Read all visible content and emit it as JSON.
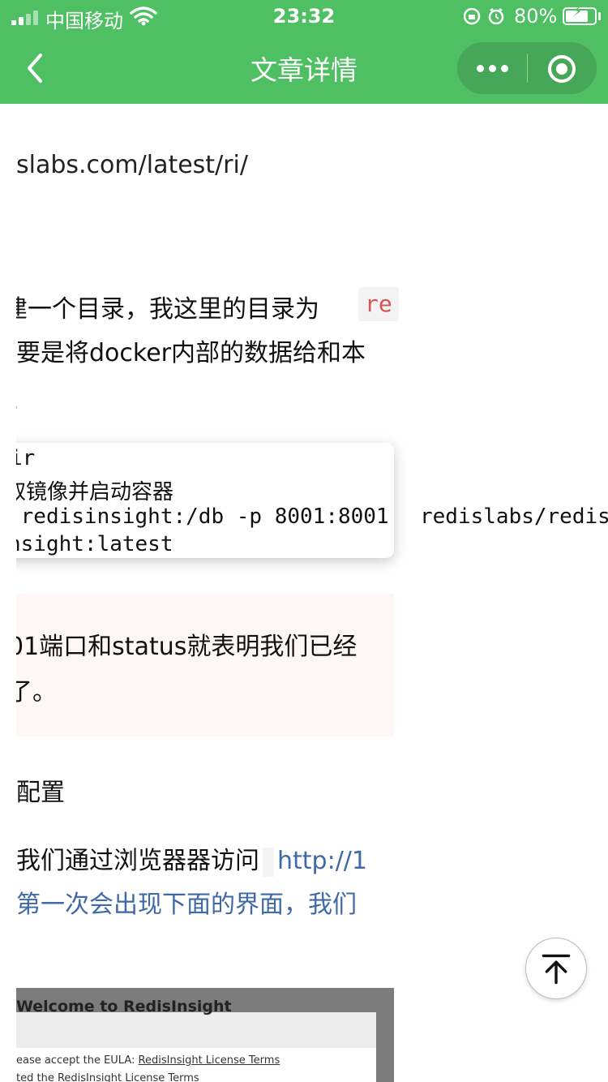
{
  "status_bar": {
    "carrier": "中国移动",
    "time": "23:32",
    "battery": "80%",
    "battery_level": 0.8
  },
  "nav": {
    "title": "文章详情",
    "back_icon": "chevron-left-icon",
    "more_icon": "more-dots-icon",
    "close_icon": "target-close-icon"
  },
  "article": {
    "url_fragment": "slabs.com/latest/ri/",
    "para1": {
      "line1": "建一个目录，我这里的目录为",
      "inline_code": "re",
      "line2": "要是将docker内部的数据给和本",
      "line3": "。"
    },
    "code_block": {
      "line1": "ir",
      "line2": "取镜像并启动容器",
      "line3": " redisinsight:/db -p 8001:8001",
      "line3_overflow": "redislabs/redis",
      "line4": "nsight:latest"
    },
    "para2": {
      "line1": "01端口和status就表明我们已经",
      "line2": "了。"
    },
    "section_heading": "配置",
    "para3": {
      "line1_text": "我们通过浏览器器访问",
      "line1_link": "http://1",
      "line2_link": "第一次会出现下面的界面，我们"
    },
    "embedded_image": {
      "title": "Welcome to RedisInsight",
      "eula_prefix": "ease accept the EULA: ",
      "eula_link": "RedisInsight License Terms",
      "line2": "ted the RedisInsight License Terms"
    }
  },
  "colors": {
    "header_bg": "#4fbf63",
    "link": "#3f6aa6",
    "inline_code": "#d9534f"
  },
  "scroll_top_icon": "arrow-up-to-top-icon"
}
